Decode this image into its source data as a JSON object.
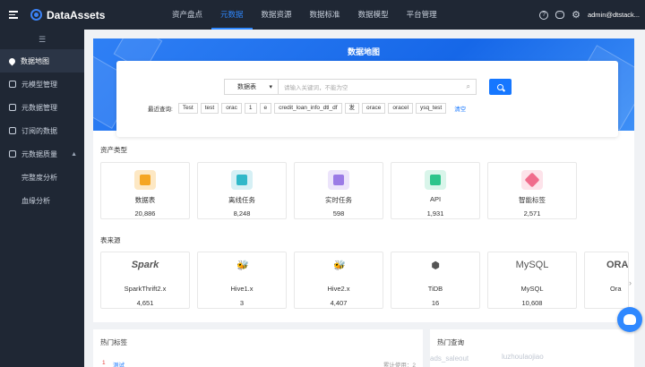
{
  "app": {
    "name": "DataAssets"
  },
  "nav": {
    "items": [
      {
        "label": "资产盘点",
        "active": false
      },
      {
        "label": "元数据",
        "active": true
      },
      {
        "label": "数据资源",
        "active": false
      },
      {
        "label": "数据标准",
        "active": false
      },
      {
        "label": "数据模型",
        "active": false
      },
      {
        "label": "平台管理",
        "active": false
      }
    ]
  },
  "header": {
    "help_glyph": "?",
    "chat_glyph": "···",
    "user": "admin@dtstack..."
  },
  "sidebar": {
    "toggle_glyph": "☰",
    "items": [
      {
        "label": "数据地图",
        "active": true,
        "icon": "map-pin-icon"
      },
      {
        "label": "元模型管理",
        "icon": "model-icon"
      },
      {
        "label": "元数据管理",
        "icon": "database-icon"
      },
      {
        "label": "订阅的数据",
        "icon": "subscribe-icon"
      },
      {
        "label": "元数据质量",
        "icon": "quality-icon",
        "expandable": true
      },
      {
        "label": "完整度分析",
        "sub": true
      },
      {
        "label": "血缘分析",
        "sub": true
      }
    ]
  },
  "banner": {
    "title": "数据地图"
  },
  "search": {
    "type_value": "数据表",
    "placeholder": "请输入关键词，不能为空",
    "recent_label": "最近查询:",
    "recent_tags": [
      "Test",
      "test",
      "orac",
      "1",
      "e",
      "credit_loan_info_dtl_df",
      "发",
      "orace",
      "oracel",
      "ysq_test"
    ],
    "clear_label": "清空"
  },
  "asset_types": {
    "title": "资产类型",
    "cards": [
      {
        "name": "数据表",
        "count": "20,886",
        "icon": "table-icon",
        "bg": "#fde8c4",
        "fg": "#f5a623"
      },
      {
        "name": "离线任务",
        "count": "8,248",
        "icon": "offline-task-icon",
        "bg": "#d6f0f5",
        "fg": "#30b8c9"
      },
      {
        "name": "实时任务",
        "count": "598",
        "icon": "realtime-task-icon",
        "bg": "#ece4fb",
        "fg": "#9b7be6"
      },
      {
        "name": "API",
        "count": "1,931",
        "icon": "api-icon",
        "bg": "#d9f5ea",
        "fg": "#2cc58b"
      },
      {
        "name": "智能标签",
        "count": "2,571",
        "icon": "smart-tag-icon",
        "bg": "#fde3ea",
        "fg": "#f06c8c"
      }
    ]
  },
  "table_sources": {
    "title": "表来源",
    "cards": [
      {
        "name": "SparkThrift2.x",
        "count": "4,651",
        "logo": "Spark",
        "icon": "spark-logo"
      },
      {
        "name": "Hive1.x",
        "count": "3",
        "logo": "",
        "icon": "hive-logo"
      },
      {
        "name": "Hive2.x",
        "count": "4,407",
        "logo": "",
        "icon": "hive-logo"
      },
      {
        "name": "TiDB",
        "count": "16",
        "logo": "",
        "icon": "tidb-logo"
      },
      {
        "name": "MySQL",
        "count": "10,608",
        "logo": "MySQL",
        "icon": "mysql-logo"
      },
      {
        "name": "Ora",
        "count": "",
        "logo": "ORA",
        "icon": "oracle-logo"
      }
    ],
    "next_glyph": "›"
  },
  "hot_tags": {
    "title": "热门标签",
    "rows": [
      {
        "rank": "1",
        "name": "测试",
        "used": "累计使用：2"
      }
    ]
  },
  "hot_queries": {
    "title": "热门查询"
  },
  "overlays": [
    "ads_saleout",
    "luzhoulaojiao"
  ]
}
